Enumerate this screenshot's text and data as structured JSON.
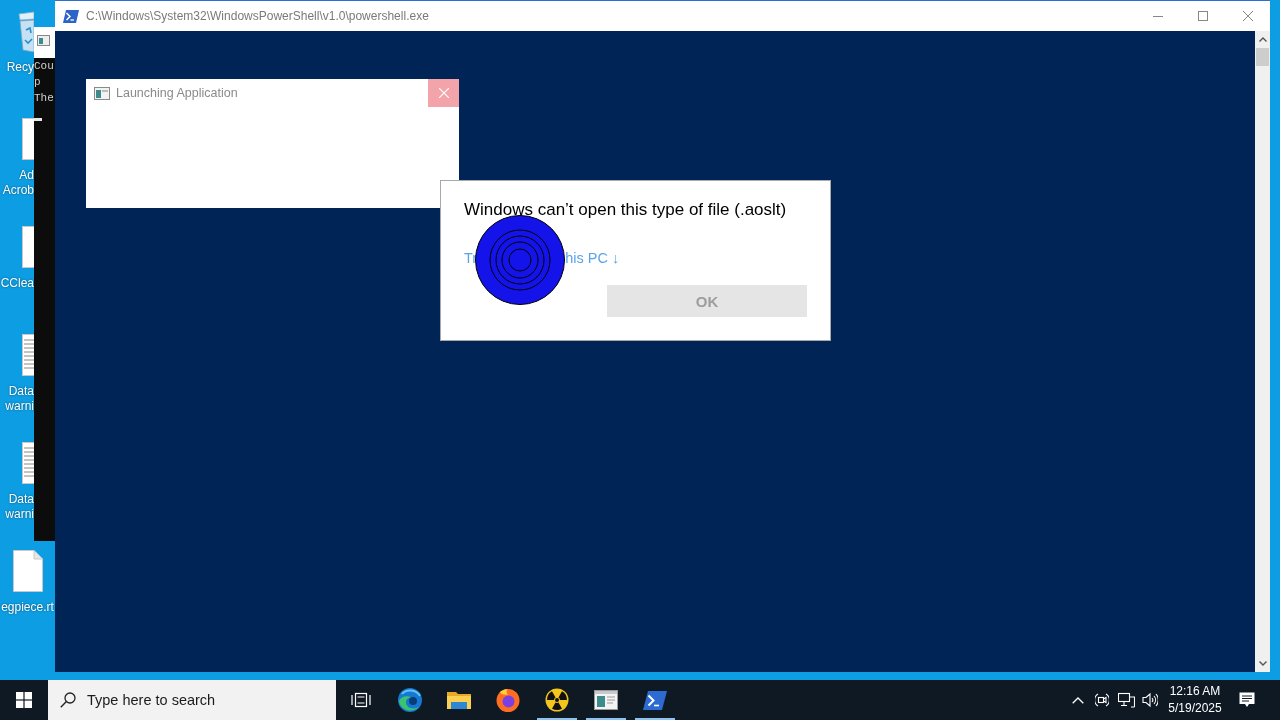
{
  "desktop_icons": [
    {
      "kind": "recycle_bin",
      "label_lines": [
        "Recy"
      ]
    },
    {
      "kind": "page",
      "label_lines": [
        "Ad",
        "Acrob"
      ]
    },
    {
      "kind": "page",
      "label_lines": [
        "CClea"
      ]
    },
    {
      "kind": "lined_page",
      "label_lines": [
        "Data",
        "warni"
      ]
    },
    {
      "kind": "lined_page",
      "label_lines": [
        "Data",
        "warni"
      ]
    },
    {
      "kind": "folded_page",
      "label_lines": [
        "egpiece.rt"
      ]
    }
  ],
  "console_window": {
    "lines": [
      "Cou",
      "p",
      "The"
    ]
  },
  "powershell_window": {
    "title": "C:\\Windows\\System32\\WindowsPowerShell\\v1.0\\powershell.exe"
  },
  "launching_window": {
    "title": "Launching Application"
  },
  "dialog": {
    "heading": "Windows can’t open this type of file (.aoslt)",
    "link_fragments": [
      "Tr",
      "his PC ↓"
    ],
    "ok_button": {
      "label": "OK",
      "disabled": true
    }
  },
  "taskbar": {
    "search": {
      "placeholder": "Type here to search"
    },
    "apps": [
      {
        "kind": "task_view",
        "running": false
      },
      {
        "kind": "edge",
        "running": false
      },
      {
        "kind": "explorer",
        "running": false
      },
      {
        "kind": "firefox",
        "running": false
      },
      {
        "kind": "radiation",
        "running": true
      },
      {
        "kind": "window_app",
        "running": true
      },
      {
        "kind": "powershell",
        "running": true
      }
    ],
    "clock": {
      "time": "12:16 AM",
      "date": "5/19/2025"
    }
  }
}
